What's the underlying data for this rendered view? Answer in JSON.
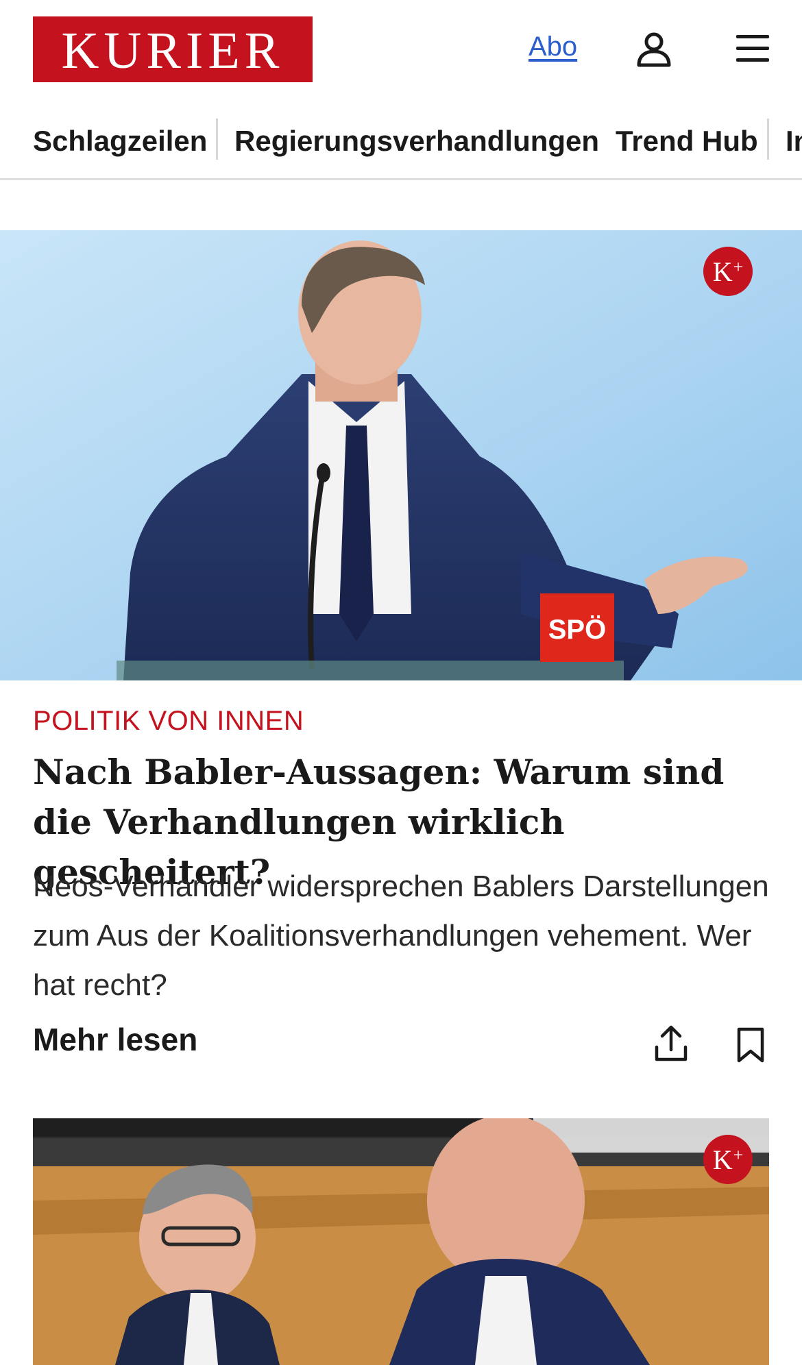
{
  "header": {
    "logo_text": "KURIER",
    "abo_label": "Abo",
    "user_icon": "user-icon",
    "menu_icon": "hamburger-menu-icon"
  },
  "nav": {
    "items": [
      {
        "label": "Schlagzeilen"
      },
      {
        "label": "Regierungsverhandlungen"
      },
      {
        "label": "Trend Hub"
      },
      {
        "label": "In"
      }
    ]
  },
  "article": {
    "badge": "K",
    "badge_plus": "+",
    "party_sign": "SPÖ",
    "kicker": "POLITIK VON INNEN",
    "headline": "Nach Babler-Aussagen: Warum sind die Verhandlungen wirklich gescheitert?",
    "teaser": "Neos-Verhandler widersprechen Bablers Darstellungen zum Aus der Koalitionsverhandlungen vehement. Wer hat recht?",
    "more_label": "Mehr lesen",
    "share_icon": "share-icon",
    "bookmark_icon": "bookmark-icon"
  },
  "second_article": {
    "badge": "K",
    "badge_plus": "+"
  },
  "colors": {
    "brand_red": "#c4121e",
    "link_blue": "#2c5fce",
    "hero_sky": "#b9dcf4"
  }
}
